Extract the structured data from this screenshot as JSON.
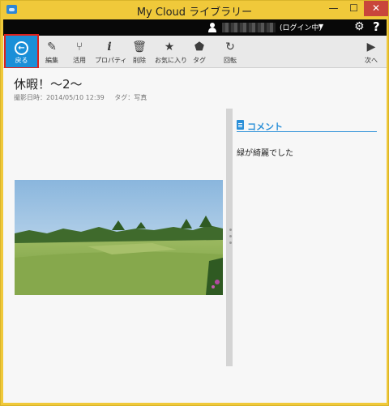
{
  "window": {
    "title": "My Cloud ライブラリー",
    "controls": {
      "minimize": "—",
      "maximize": "☐",
      "close": "✕"
    }
  },
  "account": {
    "login_status": "(ログイン中)",
    "icons": {
      "user": "user-icon",
      "dropdown": "caret-down-icon",
      "settings": "gear-icon",
      "help": "help-icon"
    },
    "settings_glyph": "⚙",
    "help_glyph": "?",
    "caret_glyph": "▼"
  },
  "toolbar": {
    "back": "戻る",
    "edit": "編集",
    "share": "活用",
    "properties": "プロパティ",
    "delete": "削除",
    "favorite": "お気に入り",
    "tag": "タグ",
    "rotate": "回転",
    "next": "次へ",
    "glyphs": {
      "back": "←",
      "edit": "✎",
      "share": "⑂",
      "properties": "i",
      "delete": "🗑",
      "favorite": "★",
      "tag": "⬟",
      "rotate": "↻",
      "next": "▶"
    }
  },
  "photo": {
    "title": "休暇！〜2〜",
    "shot_date": "撮影日時：2014/05/10 12:39",
    "tags": "タグ：写真"
  },
  "comments": {
    "header": "コメント",
    "text": "緑が綺麗でした"
  },
  "colors": {
    "accent": "#2a8fd8",
    "back_button": "#1a8fd8",
    "highlight_outline": "#e0201a",
    "titlebar": "#f0c93a"
  }
}
